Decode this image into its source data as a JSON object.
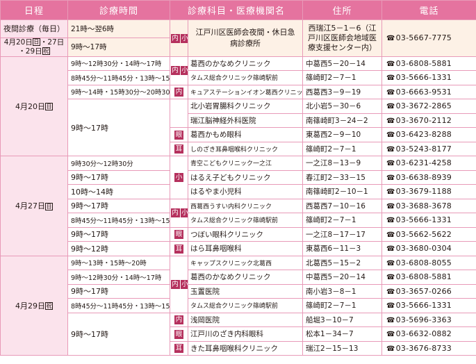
{
  "headers": [
    "日程",
    "診療時間",
    "診療科目・医療機関名",
    "住所",
    "電話"
  ],
  "top": {
    "date1": "夜間診療（毎日）",
    "date2a": "4月20日",
    "date2b": "・27日",
    "date2c": "・29日",
    "sun": "日",
    "hol": "祝",
    "time1": "21時～翌6時",
    "time2": "9時～17時",
    "dept1": "内",
    "dept2": "小",
    "institution": "江戸川区医師会夜間・休日急病診療所",
    "address": "西瑞江5－1－6（江戸川区医師会地域医療支援センター内）",
    "tel": "03-5667-7775"
  },
  "groups": [
    {
      "date": "4月20日",
      "day_mark": "日",
      "rows": [
        {
          "time": "9時～12時30分・14時～17時",
          "dept": [
            "内",
            "小"
          ],
          "name": "葛西のかなめクリニック",
          "addr": "中葛西5－20－14",
          "tel": "03-6808-5881"
        },
        {
          "time": "8時45分～11時45分・13時～15時",
          "dept": [],
          "name": "タムス総合クリニック篠崎駅前",
          "addr": "篠崎町2－7－1",
          "tel": "03-5666-1331"
        },
        {
          "time": "9時～14時・15時30分～20時30分",
          "dept": [
            "内"
          ],
          "name": "キュアステーションイオン葛西クリニック",
          "addr": "西葛西3－9－19",
          "tel": "03-6663-9531"
        },
        {
          "time": "9時～17時",
          "dept": [],
          "name": "北小岩胃腸科クリニック",
          "addr": "北小岩5－30－6",
          "tel": "03-3672-2865"
        },
        {
          "time": "",
          "dept": [],
          "name": "瑞江脳神経外科医院",
          "addr": "南篠崎町3－24－2",
          "tel": "03-3670-2112"
        },
        {
          "time": "",
          "dept": [
            "眼"
          ],
          "name": "葛西かもめ眼科",
          "addr": "東葛西2－9－10",
          "tel": "03-6423-8288"
        },
        {
          "time": "",
          "dept": [
            "耳"
          ],
          "name": "しのざき耳鼻咽喉科クリニック",
          "addr": "篠崎町2－7－1",
          "tel": "03-5243-8177"
        }
      ]
    },
    {
      "date": "4月27日",
      "day_mark": "日",
      "rows": [
        {
          "time": "9時30分～12時30分",
          "dept": [
            "小"
          ],
          "name": "青空こどもクリニック一之江",
          "addr": "一之江8－13－9",
          "tel": "03-6231-4258"
        },
        {
          "time": "9時～17時",
          "dept": [],
          "name": "はるえ子どもクリニック",
          "addr": "春江町2－33－15",
          "tel": "03-6638-8939"
        },
        {
          "time": "10時～14時",
          "dept": [],
          "name": "はるやま小児科",
          "addr": "南篠崎町2－10－1",
          "tel": "03-3679-1188"
        },
        {
          "time": "9時～17時",
          "dept": [
            "内",
            "小"
          ],
          "name": "西葛西うすい内科クリニック",
          "addr": "西葛西7－10－16",
          "tel": "03-3688-3678"
        },
        {
          "time": "8時45分～11時45分・13時～15時",
          "dept": [],
          "name": "タムス総合クリニック篠崎駅前",
          "addr": "篠崎町2－7－1",
          "tel": "03-5666-1331"
        },
        {
          "time": "9時～17時",
          "dept": [
            "眼"
          ],
          "name": "つぼい眼科クリニック",
          "addr": "一之江8－17－17",
          "tel": "03-5662-5622"
        },
        {
          "time": "9時～12時",
          "dept": [
            "耳"
          ],
          "name": "はら耳鼻咽喉科",
          "addr": "東葛西6－11－3",
          "tel": "03-3680-0304"
        }
      ]
    },
    {
      "date": "4月29日",
      "day_mark": "祝",
      "rows": [
        {
          "time": "9時～13時・15時～20時",
          "dept": [
            "内",
            "小"
          ],
          "name": "キャップスクリニック北葛西",
          "addr": "北葛西5－15－2",
          "tel": "03-6808-8055"
        },
        {
          "time": "9時～12時30分・14時～17時",
          "dept": [],
          "name": "葛西のかなめクリニック",
          "addr": "中葛西5－20－14",
          "tel": "03-6808-5881"
        },
        {
          "time": "9時～17時",
          "dept": [],
          "name": "玉置医院",
          "addr": "南小岩3－8－1",
          "tel": "03-3657-0266"
        },
        {
          "time": "8時45分～11時45分・13時～15時",
          "dept": [],
          "name": "タムス総合クリニック篠崎駅前",
          "addr": "篠崎町2－7－1",
          "tel": "03-5666-1331"
        },
        {
          "time": "9時～17時",
          "dept": [
            "内"
          ],
          "name": "浅岡医院",
          "addr": "船堀3－10－7",
          "tel": "03-5696-3363"
        },
        {
          "time": "",
          "dept": [
            "眼"
          ],
          "name": "江戸川のざき内科眼科",
          "addr": "松本1－34－7",
          "tel": "03-6632-0882"
        },
        {
          "time": "",
          "dept": [
            "耳"
          ],
          "name": "きた耳鼻咽喉科クリニック",
          "addr": "瑞江2－15－13",
          "tel": "03-3676-8733"
        }
      ]
    }
  ]
}
